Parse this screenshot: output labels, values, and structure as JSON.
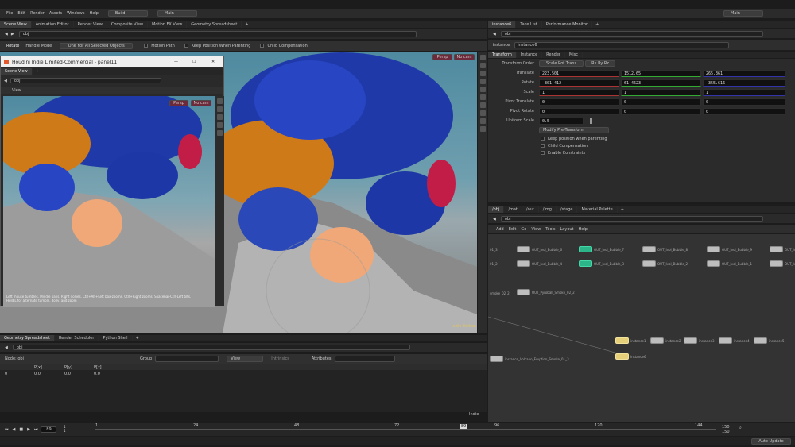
{
  "menubar": {
    "items": [
      "File",
      "Edit",
      "Render",
      "Assets",
      "Windows",
      "Help"
    ],
    "desktop": "Build",
    "context": "Main",
    "right_desktop": "Main"
  },
  "left_tabs": [
    "Scene View",
    "Animation Editor",
    "Render View",
    "Composite View",
    "Motion FX View",
    "Geometry Spreadsheet"
  ],
  "path": {
    "main": "obj",
    "stage": "obj",
    "float": "obj",
    "spread": "obj"
  },
  "toolbar": {
    "tool": "Rotate",
    "mode": "Handle Mode",
    "objects": "One For All Selected Objects",
    "motion": "Motion Path",
    "keep": "Keep Position When Parenting",
    "child": "Child Compensation"
  },
  "viewport": {
    "persp": "Persp",
    "cam": "No cam",
    "watermark": "Indie Edition"
  },
  "float_window": {
    "title": "Houdini Indie Limited-Commercial - panel11",
    "tab": "Scene View",
    "view_label": "View",
    "persp": "Persp",
    "cam": "No cam",
    "hint1": "Left mouse tumbles. Middle pans. Right dollies. Ctrl+Alt+Left box-zooms. Ctrl+Right zooms. Spacebar-Ctrl-Left tilts.",
    "hint2": "Hold L for alternate tumble, dolly, and zoom"
  },
  "bottom_tabs": [
    "Geometry Spreadsheet",
    "Render Scheduler",
    "Python Shell"
  ],
  "spreadsheet": {
    "node": "Node: obj",
    "group_label": "Group",
    "view_label": "View",
    "intrinsics": "Intrinsics",
    "attributes": "Attributes",
    "columns": [
      "P[x]",
      "P[y]",
      "P[z]"
    ],
    "rows": [
      {
        "index": "0",
        "x": "0.0",
        "y": "0.0",
        "z": "0.0"
      }
    ],
    "indie": "Indie"
  },
  "timeline": {
    "frame": "89",
    "start": "1",
    "start2": "1",
    "end": "150",
    "end2": "150",
    "auto_update": "Auto Update",
    "ticks": [
      "1",
      "24",
      "48",
      "72",
      "96",
      "120",
      "144"
    ]
  },
  "param_tabs": [
    "instance6",
    "Take List",
    "Performance Monitor"
  ],
  "params": {
    "type": "instance",
    "name": "instance6",
    "subtabs": [
      "Transform",
      "Instance",
      "Render",
      "Misc"
    ],
    "transform_order_label": "Transform Order",
    "order1": "Scale Rot Trans",
    "order2": "Rx Ry Rz",
    "rows": [
      {
        "label": "Translate",
        "v": [
          "223.501",
          "1512.65",
          "265.361"
        ]
      },
      {
        "label": "Rotate",
        "v": [
          "-301.412",
          "61.4623",
          "-355.616"
        ]
      },
      {
        "label": "Scale",
        "v": [
          "1",
          "1",
          "1"
        ]
      },
      {
        "label": "Pivot Translate",
        "v": [
          "0",
          "0",
          "0"
        ]
      },
      {
        "label": "Pivot Rotate",
        "v": [
          "0",
          "0",
          "0"
        ]
      }
    ],
    "uniform_label": "Uniform Scale",
    "uniform": "0.5",
    "pretransform": "Modify Pre-Transform",
    "checks": [
      "Keep position when parenting",
      "Child Compensation",
      "Enable Constraints"
    ]
  },
  "net_tabs": [
    "/obj",
    "/mat",
    "/out",
    "/img",
    "/stage",
    "Material Palette"
  ],
  "net_path": "obj",
  "net_menu": [
    "Add",
    "Edit",
    "Go",
    "View",
    "Tools",
    "Layout",
    "Help"
  ],
  "nodes": [
    {
      "l": "OUT_Ivol_Bubble_6",
      "c": ""
    },
    {
      "l": "OUT_Ivol_Bubble_7",
      "c": "g"
    },
    {
      "l": "OUT_Ivol_Bubble_8",
      "c": ""
    },
    {
      "l": "OUT_Ivol_Bubble_9",
      "c": ""
    },
    {
      "l": "OUT_Ivol_Bubble_5",
      "c": ""
    },
    {
      "l": "OUT_Ivol_Bubble_4",
      "c": ""
    },
    {
      "l": "OUT_Ivol_Bubble_3",
      "c": "g"
    },
    {
      "l": "OUT_Ivol_Bubble_2",
      "c": ""
    },
    {
      "l": "OUT_Ivol_Bubble_1",
      "c": ""
    },
    {
      "l": "OUT_Ivol_Bubble_0",
      "c": ""
    },
    {
      "l": "OUT_Pyroball_Smoke_02_2",
      "c": ""
    },
    {
      "l": "instance_Volcano_Eruption_Smoke_01_3",
      "c": ""
    },
    {
      "l": "instance1",
      "c": "y"
    },
    {
      "l": "instance2",
      "c": ""
    },
    {
      "l": "instance3",
      "c": ""
    },
    {
      "l": "instance4",
      "c": ""
    },
    {
      "l": "instance5",
      "c": ""
    },
    {
      "l": "instance6",
      "c": "y"
    }
  ],
  "node_side_labels": [
    "01_3",
    "01_2",
    "smoke_02_2"
  ]
}
